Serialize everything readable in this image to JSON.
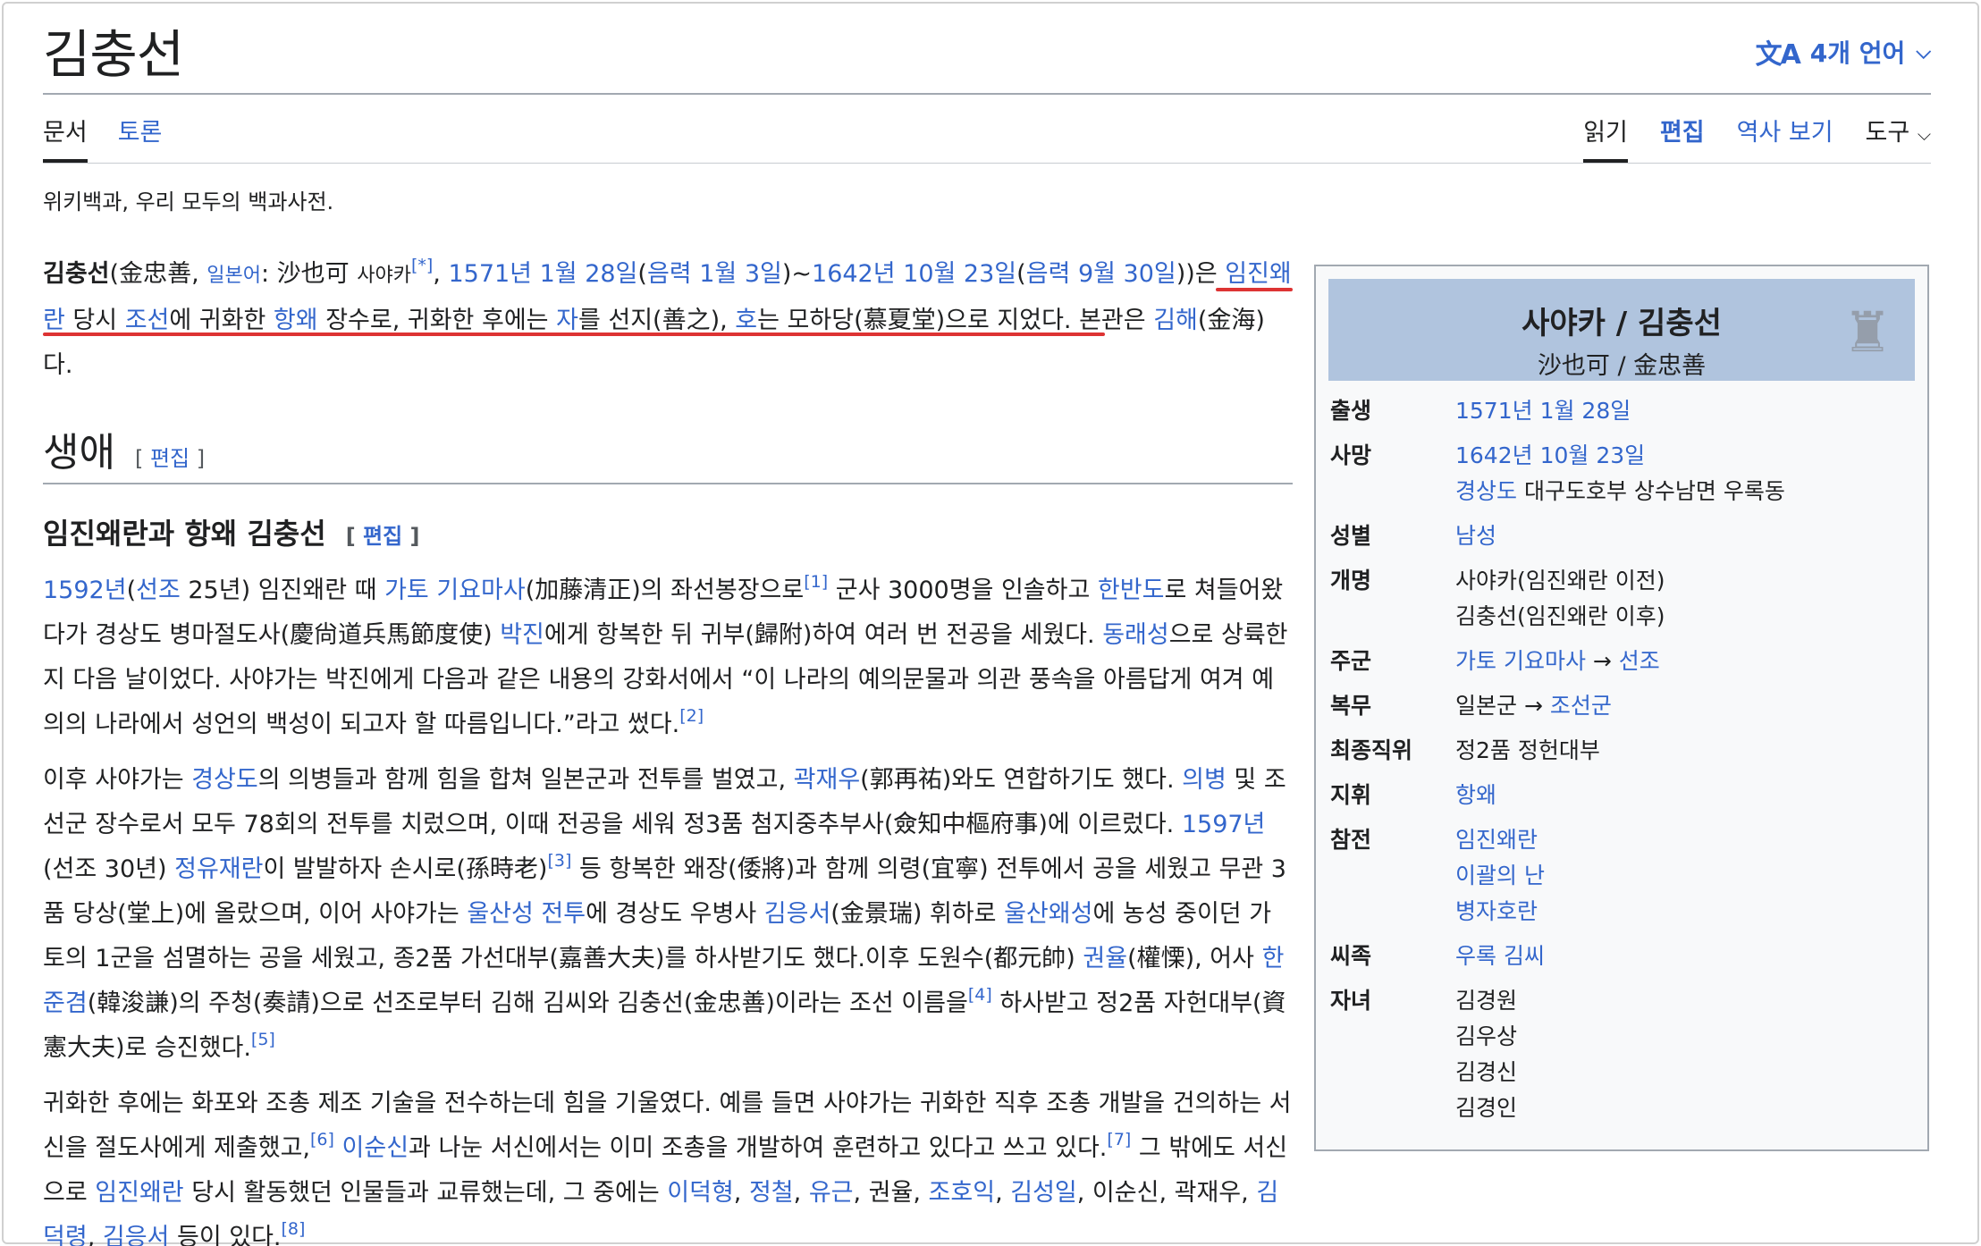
{
  "title": "김충선",
  "lang_button": {
    "icon": "文A",
    "label": "4개 언어",
    "chevron": "⌵"
  },
  "tabs_left": [
    "문서",
    "토론"
  ],
  "tabs_right": {
    "read": "읽기",
    "edit": "편집",
    "history": "역사 보기",
    "tools": "도구"
  },
  "tagline": "위키백과, 우리 모두의 백과사전.",
  "lead": {
    "p1": "김충선",
    "p2": "(金忠善, ",
    "p3": "일본어",
    "p4": ": 沙也可 ",
    "p5": "사야카",
    "p6": "[*]",
    "p7": ", ",
    "p8": "1571년 1월 28일",
    "p9": "(",
    "p10": "음력 1월 3일",
    "p11": ")~",
    "p12": "1642년 10월 23일",
    "p13": "(",
    "p14": "음력 9월 30일",
    "p15": "))은 ",
    "p16": "임진왜란",
    "p17": " 당시 ",
    "p18": "조선",
    "p19": "에 귀화한 ",
    "p20": "항왜",
    "p21": " 장수로, 귀화한 후에는 ",
    "p22": "자",
    "p23": "를 선지(善之), ",
    "p24": "호",
    "p25": "는 모하당(慕夏堂)으로 지었다. 본관은 ",
    "p26": "김해",
    "p27": "(金海)다."
  },
  "section_life": {
    "title": "생애",
    "edit_open": "[ ",
    "edit": "편집",
    "edit_close": " ]"
  },
  "section_war": {
    "title": "임진왜란과 항왜 김충선",
    "edit_open": "[ ",
    "edit": "편집",
    "edit_close": " ]"
  },
  "para2": {
    "a1": "1592년",
    "a2": "(",
    "a3": "선조",
    "a4": " 25년) 임진왜란 때 ",
    "a5": "가토 기요마사",
    "a6": "(加藤清正)의 좌선봉장으로",
    "a7": "[1]",
    "a8": " 군사 3000명을 인솔하고 ",
    "a9": "한반도",
    "a10": "로 쳐들어왔다가 경상도 병마절도사(慶尙道兵馬節度使) ",
    "a11": "박진",
    "a12": "에게 항복한 뒤 귀부(歸附)하여 여러 번 전공을 세웠다. ",
    "a13": "동래성",
    "a14": "으로 상륙한 지 다음 날이었다. 사야가는 박진에게 다음과 같은 내용의 강화서에서 “이 나라의 예의문물과 의관 풍속을 아름답게 여겨 예의의 나라에서 성언의 백성이 되고자 할 따름입니다.”라고 썼다.",
    "a15": "[2]"
  },
  "para3": {
    "b1": "이후 사야가는 ",
    "b2": "경상도",
    "b3": "의 의병들과 함께 힘을 합쳐 일본군과 전투를 벌였고, ",
    "b4": "곽재우",
    "b5": "(郭再祐)와도 연합하기도 했다. ",
    "b6": "의병",
    "b7": " 및 조선군 장수로서 모두 78회의 전투를 치렀으며, 이때 전공을 세워 정3품 첨지중추부사(僉知中樞府事)에 이르렀다. ",
    "b8": "1597년",
    "b9": "(선조 30년) ",
    "b10": "정유재란",
    "b11": "이 발발하자 손시로(孫時老)",
    "b12": "[3]",
    "b13": " 등 항복한 왜장(倭將)과 함께 의령(宜寧) 전투에서 공을 세웠고 무관 3품 당상(堂上)에 올랐으며, 이어 사야가는 ",
    "b14": "울산성 전투",
    "b15": "에 경상도 우병사 ",
    "b16": "김응서",
    "b17": "(金景瑞) 휘하로 ",
    "b18": "울산왜성",
    "b19": "에 농성 중이던 가토의 1군을 섬멸하는 공을 세웠고, 종2품 가선대부(嘉善大夫)를 하사받기도 했다.이후 도원수(都元帥) ",
    "b20": "권율",
    "b21": "(權慄), 어사 ",
    "b22": "한준겸",
    "b23": "(韓浚謙)의 주청(奏請)으로 선조로부터 김해 김씨와 김충선(金忠善)이라는 조선 이름을",
    "b24": "[4]",
    "b25": " 하사받고 정2품 자헌대부(資憲大夫)로 승진했다.",
    "b26": "[5]"
  },
  "para4": {
    "c1": "귀화한 후에는 화포와 조총 제조 기술을 전수하는데 힘을 기울였다. 예를 들면 사야가는 귀화한 직후 조총 개발을 건의하는 서신을 절도사에게 제출했고,",
    "c2": "[6]",
    "c3": " ",
    "c4": "이순신",
    "c5": "과 나눈 서신에서는 이미 조총을 개발하여 훈련하고 있다고 쓰고 있다.",
    "c6": "[7]",
    "c7": " 그 밖에도 서신으로 ",
    "c8": "임진왜란",
    "c9": " 당시 활동했던 인물들과 교류했는데, 그 중에는 ",
    "c10": "이덕형",
    "c11": ", ",
    "c12": "정철",
    "c13": ", ",
    "c14": "유근",
    "c15": ", 권율, ",
    "c16": "조호익",
    "c17": ", ",
    "c18": "김성일",
    "c19": ", 이순신, 곽재우, ",
    "c20": "김덕령",
    "c21": ", ",
    "c22": "김응서",
    "c23": " 등이 있다.",
    "c24": "[8]"
  },
  "infobox": {
    "name": "사야카 / 김충선",
    "subname": "沙也可 / 金忠善",
    "rows": [
      {
        "key": "출생",
        "v1": "1571년 1월 28일"
      },
      {
        "key": "사망",
        "v1": "1642년 10월 23일",
        "v2a": "경상도",
        "v2b": " 대구도호부 상수남면 우록동"
      },
      {
        "key": "성별",
        "v1": "남성"
      },
      {
        "key": "개명",
        "v1": "사야카(임진왜란 이전)",
        "v2": "김충선(임진왜란 이후)"
      },
      {
        "key": "주군",
        "v1a": "가토 기요마사",
        "v1b": " → ",
        "v1c": "선조"
      },
      {
        "key": "복무",
        "v1a": "일본군",
        "v1b": " → ",
        "v1c": "조선군"
      },
      {
        "key": "최종직위",
        "v1": "정2품 정헌대부"
      },
      {
        "key": "지휘",
        "v1": "항왜"
      },
      {
        "key": "참전",
        "v1": "임진왜란",
        "v2": "이괄의 난",
        "v3": "병자호란"
      },
      {
        "key": "씨족",
        "v1": "우록 김씨"
      },
      {
        "key": "자녀",
        "v1": "김경원",
        "v2": "김우상",
        "v3": "김경신",
        "v4": "김경인"
      }
    ]
  },
  "colors": {
    "link": "#3366cc",
    "text": "#202122",
    "infobox_header": "#b0c4de",
    "underline": "#dd3333"
  }
}
